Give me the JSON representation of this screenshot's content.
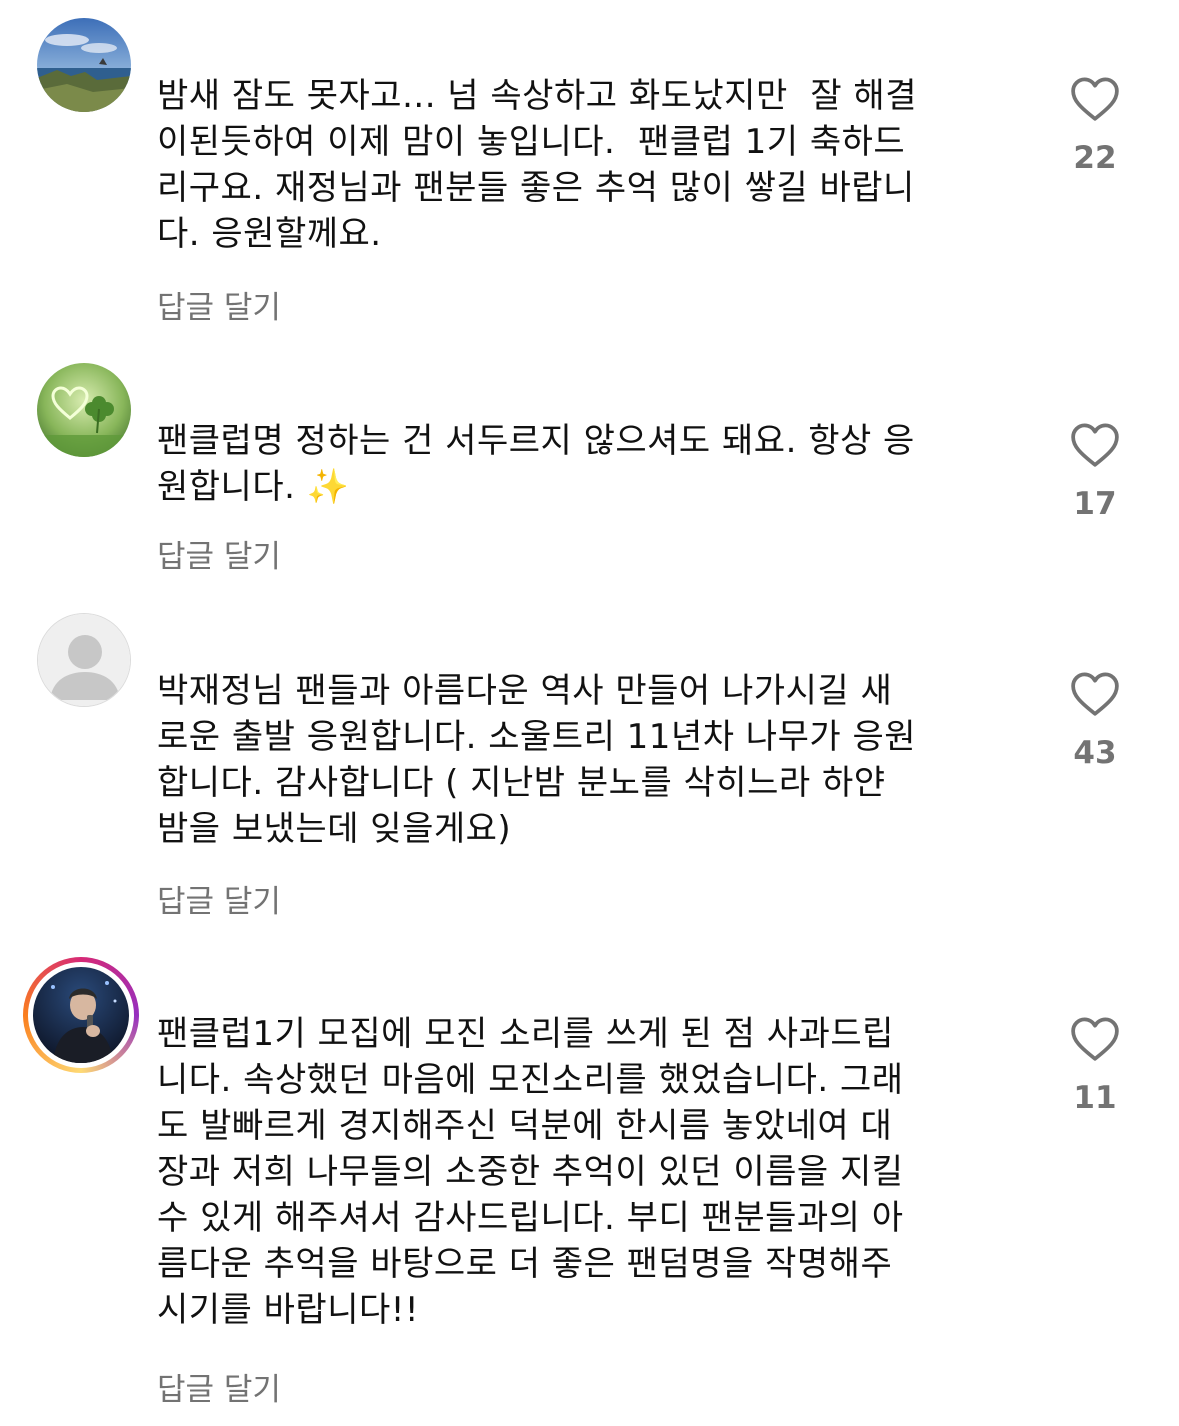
{
  "comments": [
    {
      "text": "밤새 잠도 못자고... 넘 속상하고 화도났지만  잘 해결\n이된듯하여 이제 맘이 놓입니다.  팬클럽 1기 축하드\n리구요. 재정님과 팬분들 좋은 추억 많이 쌓길 바랍니\n다. 응원할께요.",
      "reply_label": "답글 달기",
      "likes": "22",
      "avatar": "landscape-sea-photo"
    },
    {
      "text": "팬클럽명 정하는 건 서두르지 않으셔도 돼요. 항상 응\n원합니다. ✨",
      "reply_label": "답글 달기",
      "likes": "17",
      "avatar": "heart-clover-photo"
    },
    {
      "text": "박재정님 팬들과 아름다운 역사 만들어 나가시길 새\n로운 출발 응원합니다. 소울트리 11년차 나무가 응원\n합니다. 감사합니다 ( 지난밤 분노를 삭히느라 하얀\n밤을 보냈는데 잊을게요)",
      "reply_label": "답글 달기",
      "likes": "43",
      "avatar": "default-user"
    },
    {
      "text": "팬클럽1기 모집에 모진 소리를 쓰게 된 점 사과드립\n니다. 속상했던 마음에 모진소리를 했었습니다. 그래\n도 발빠르게 경지해주신 덕분에 한시름 놓았네여 대\n장과 저희 나무들의 소중한 추억이 있던 이름을 지킬\n수 있게 해주셔서 감사드립니다. 부디 팬분들과의 아\n름다운 추억을 바탕으로 더 좋은 팬덤명을 작명해주\n시기를 바랍니다!!",
      "reply_label": "답글 달기",
      "likes": "11",
      "avatar": "singer-story-ring"
    }
  ],
  "colors": {
    "text": "#111111",
    "secondary": "#737373",
    "story_ring": "#d62976"
  }
}
